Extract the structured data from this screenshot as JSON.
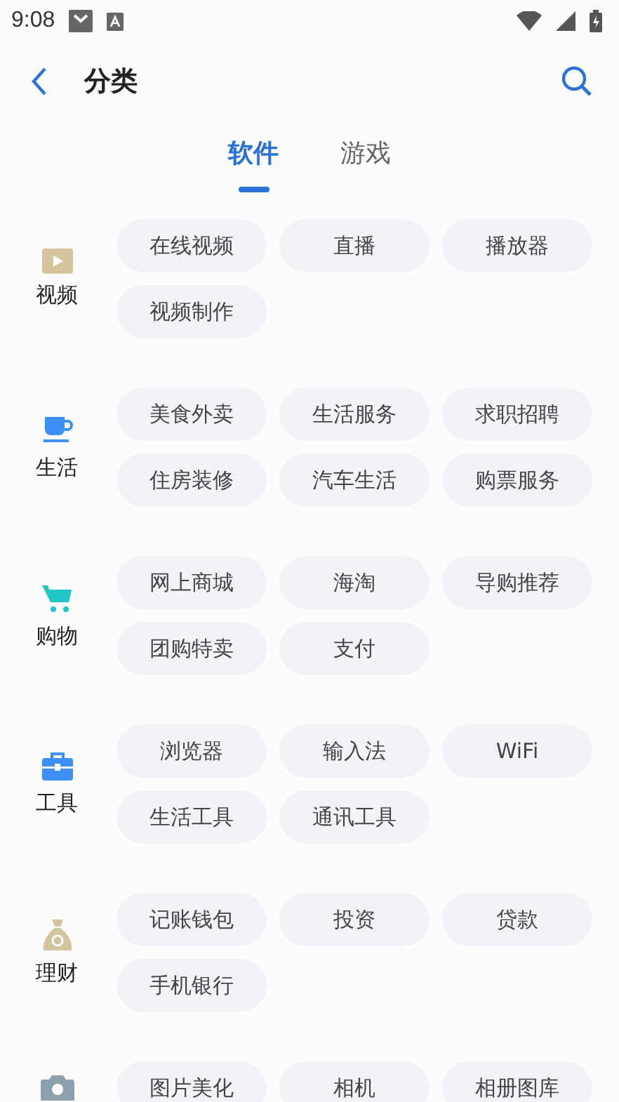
{
  "status_bar": {
    "time": "9:08"
  },
  "header": {
    "title": "分类"
  },
  "tabs": [
    {
      "label": "软件",
      "selected": true
    },
    {
      "label": "游戏",
      "selected": false
    }
  ],
  "categories": [
    {
      "kind": "video",
      "label": "视频",
      "items": [
        "在线视频",
        "直播",
        "播放器",
        "视频制作"
      ]
    },
    {
      "kind": "cup",
      "label": "生活",
      "items": [
        "美食外卖",
        "生活服务",
        "求职招聘",
        "住房装修",
        "汽车生活",
        "购票服务"
      ]
    },
    {
      "kind": "cart",
      "label": "购物",
      "items": [
        "网上商城",
        "海淘",
        "导购推荐",
        "团购特卖",
        "支付"
      ]
    },
    {
      "kind": "toolbox",
      "label": "工具",
      "items": [
        "浏览器",
        "输入法",
        "WiFi",
        "生活工具",
        "通讯工具"
      ]
    },
    {
      "kind": "moneybag",
      "label": "理财",
      "items": [
        "记账钱包",
        "投资",
        "贷款",
        "手机银行"
      ]
    },
    {
      "kind": "camera",
      "items": [
        "图片美化",
        "相机",
        "相册图库"
      ]
    }
  ]
}
